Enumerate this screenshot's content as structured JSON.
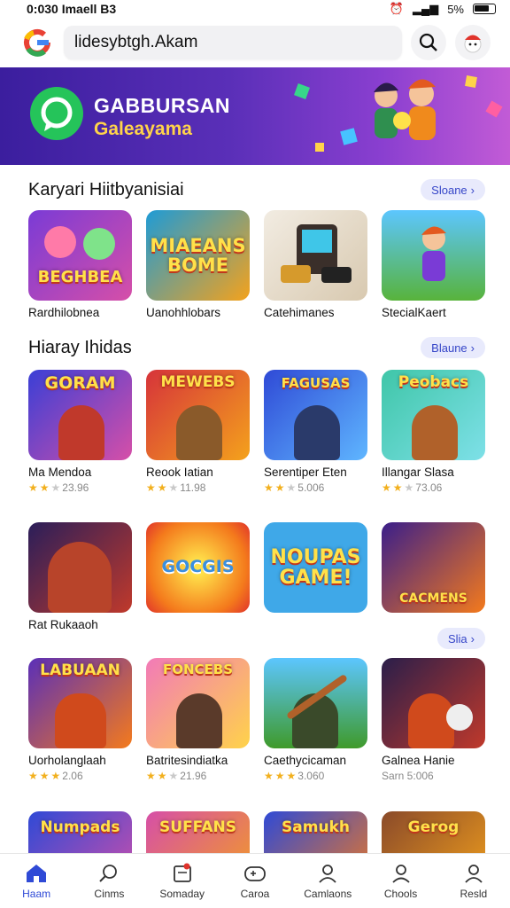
{
  "status_bar": {
    "time": "0:030 Imaell B3",
    "signal_text": "5%"
  },
  "search": {
    "value": "lidesybtgh.Akam"
  },
  "banner": {
    "title": "GABBURSAN",
    "subtitle": "Galeayama"
  },
  "section1": {
    "title": "Karyari Hiitbyanisiai",
    "more_label": "Sloane",
    "items": [
      {
        "name": "Rardhilobnea",
        "art_text": "BEGHBEA"
      },
      {
        "name": "Uanohhlobars",
        "art_text": "MIAEANS BOME"
      },
      {
        "name": "Catehimanes",
        "art_text": ""
      },
      {
        "name": "StecialKaert",
        "art_text": ""
      }
    ]
  },
  "section2": {
    "title": "Hiaray Ihidas",
    "more_label": "Blaune",
    "row1": [
      {
        "name": "Ma Mendoa",
        "rating_text": "23.96",
        "stars": 2,
        "art_text": "GORAM"
      },
      {
        "name": "Reook Iatian",
        "rating_text": "11.98",
        "stars": 2,
        "art_text": "MEWEBS"
      },
      {
        "name": "Serentiper Eten",
        "rating_text": "5.006",
        "stars": 2,
        "art_text": "FAGUSAS"
      },
      {
        "name": "Illangar Slasa",
        "rating_text": "73.06",
        "stars": 2,
        "art_text": "Peobacs"
      }
    ],
    "row2": [
      {
        "name": "Rat Rukaaoh",
        "art_text": ""
      },
      {
        "name": "",
        "art_text": "GOCGIS"
      },
      {
        "name": "",
        "art_text": "NOUPAS GAME!"
      },
      {
        "name": "",
        "art_text": "CACMENS"
      }
    ],
    "row2_more_label": "Slia",
    "row3": [
      {
        "name": "Uorholanglaah",
        "rating_text": "2.06",
        "stars": 3,
        "art_text": "LABUAAN"
      },
      {
        "name": "Batritesindiatka",
        "rating_text": "21.96",
        "stars": 2,
        "art_text": "FONCEBS"
      },
      {
        "name": "Caethycicaman",
        "rating_text": "3.060",
        "stars": 3,
        "art_text": ""
      },
      {
        "name": "Galnea Hanie",
        "rating_text": "Sarn 5:006",
        "stars": 0,
        "art_text": ""
      }
    ],
    "row4": [
      {
        "art_text": "Numpads"
      },
      {
        "art_text": "SUFFANS"
      },
      {
        "art_text": "Samukh"
      },
      {
        "art_text": "Gerog"
      }
    ]
  },
  "bottom_nav": [
    {
      "label": "Haam",
      "icon": "home-icon",
      "active": true
    },
    {
      "label": "Cinms",
      "icon": "search-icon",
      "active": false
    },
    {
      "label": "Somaday",
      "icon": "calendar-icon",
      "active": false
    },
    {
      "label": "Caroa",
      "icon": "gamepad-icon",
      "active": false
    },
    {
      "label": "Camlaons",
      "icon": "person-icon",
      "active": false
    },
    {
      "label": "Chools",
      "icon": "people-icon",
      "active": false
    },
    {
      "label": "Resld",
      "icon": "profile-icon",
      "active": false
    }
  ],
  "colors": {
    "accent": "#2f4ad6",
    "banner_start": "#3b1e9e",
    "banner_end": "#c25bd6",
    "pill_bg": "#e8eafc",
    "star": "#f2b01e"
  }
}
